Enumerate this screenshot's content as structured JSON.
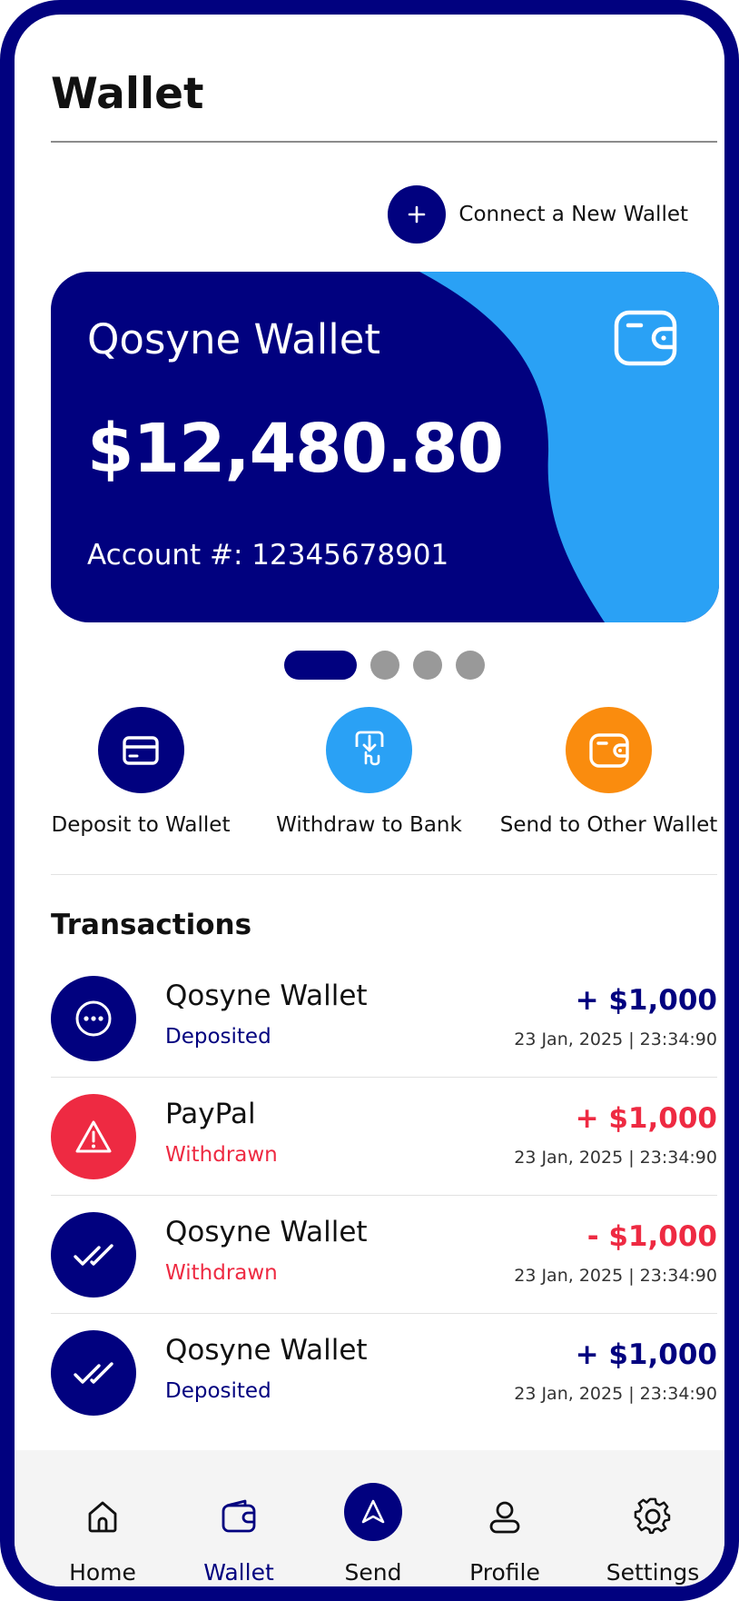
{
  "page": {
    "title": "Wallet"
  },
  "connect": {
    "label": "Connect a New Wallet",
    "icon": "plus-icon"
  },
  "card": {
    "name": "Qosyne Wallet",
    "balance": "$12,480.80",
    "account": "Account #: 12345678901",
    "icon": "wallet-icon",
    "colors": {
      "primary": "#01017f",
      "accent": "#2aa1f5"
    }
  },
  "carousel": {
    "total_pages": 4,
    "active_page": 1
  },
  "actions": [
    {
      "label": "Deposit to Wallet",
      "icon": "card-icon",
      "color": "#01017f"
    },
    {
      "label": "Withdraw to Bank",
      "icon": "withdraw-hand-icon",
      "color": "#2aa1f5"
    },
    {
      "label": "Send to Other Wallet",
      "icon": "wallet-icon",
      "color": "#fa8c0e"
    }
  ],
  "transactions": {
    "heading": "Transactions",
    "items": [
      {
        "name": "Qosyne Wallet",
        "status": "Deposited",
        "amount": "+ $1,000",
        "date": "23 Jan, 2025 | 23:34:90",
        "icon": "more-dots-icon",
        "icon_bg": "#01017f",
        "status_color": "#01017f",
        "amount_color": "#01017f"
      },
      {
        "name": "PayPal",
        "status": "Withdrawn",
        "amount": "+ $1,000",
        "date": "23 Jan, 2025 | 23:34:90",
        "icon": "warning-icon",
        "icon_bg": "#ee2a42",
        "status_color": "#ee2a42",
        "amount_color": "#ee2a42"
      },
      {
        "name": "Qosyne Wallet",
        "status": "Withdrawn",
        "amount": "- $1,000",
        "date": "23 Jan, 2025 | 23:34:90",
        "icon": "double-check-icon",
        "icon_bg": "#01017f",
        "status_color": "#ee2a42",
        "amount_color": "#ee2a42"
      },
      {
        "name": "Qosyne Wallet",
        "status": "Deposited",
        "amount": "+ $1,000",
        "date": "23 Jan, 2025 | 23:34:90",
        "icon": "double-check-icon",
        "icon_bg": "#01017f",
        "status_color": "#01017f",
        "amount_color": "#01017f"
      }
    ]
  },
  "nav": {
    "active": "Wallet",
    "items": [
      {
        "label": "Home",
        "icon": "home-icon"
      },
      {
        "label": "Wallet",
        "icon": "wallet-icon"
      },
      {
        "label": "Send",
        "icon": "send-arrow-icon"
      },
      {
        "label": "Profile",
        "icon": "user-icon"
      },
      {
        "label": "Settings",
        "icon": "gear-icon"
      }
    ],
    "active_color": "#01017f"
  }
}
